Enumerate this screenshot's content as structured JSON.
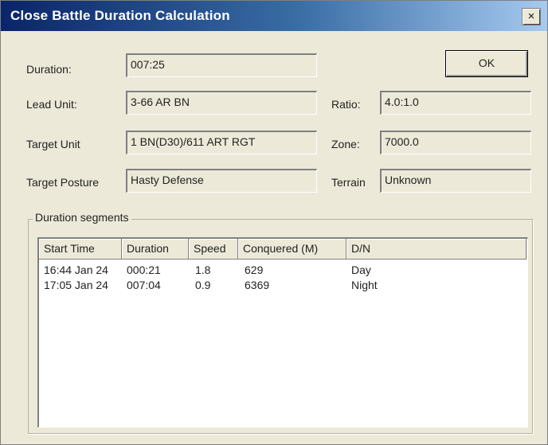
{
  "window": {
    "title": "Close Battle Duration Calculation"
  },
  "fields": {
    "duration": {
      "label": "Duration:",
      "value": "007:25"
    },
    "lead_unit": {
      "label": "Lead Unit:",
      "value": "3-66 AR BN"
    },
    "target_unit": {
      "label": "Target Unit",
      "value": "1 BN(D30)/611 ART RGT"
    },
    "target_posture": {
      "label": "Target Posture",
      "value": "Hasty Defense"
    },
    "ratio": {
      "label": "Ratio:",
      "value": "4.0:1.0"
    },
    "zone": {
      "label": "Zone:",
      "value": "7000.0"
    },
    "terrain": {
      "label": "Terrain",
      "value": "Unknown"
    }
  },
  "buttons": {
    "ok": "OK",
    "close": "×"
  },
  "segments": {
    "title": "Duration segments",
    "columns": [
      "Start Time",
      "Duration",
      "Speed",
      "Conquered (M)",
      "D/N"
    ],
    "rows": [
      [
        "16:44 Jan 24",
        "000:21",
        "1.8",
        "629",
        "Day"
      ],
      [
        "17:05 Jan 24",
        "007:04",
        "0.9",
        "6369",
        "Night"
      ]
    ]
  }
}
